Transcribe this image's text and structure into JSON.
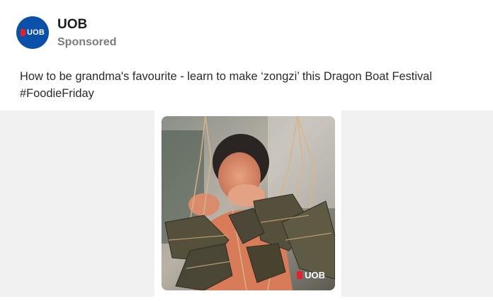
{
  "post": {
    "author": "UOB",
    "avatar_text": "UOB",
    "label": "Sponsored",
    "text_line1": "How to be grandma's favourite - learn to make ‘zongzi’ this Dragon Boat Festival",
    "text_line2": "#FoodieFriday"
  },
  "media": {
    "watermark_text": "UOB"
  },
  "colors": {
    "brand_blue": "#0a4fa8",
    "brand_red": "#e3202b"
  }
}
